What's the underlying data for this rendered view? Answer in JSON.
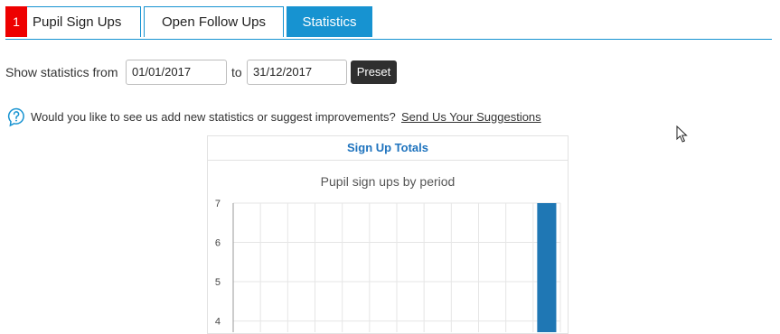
{
  "tabs": [
    {
      "badge": "1",
      "label": "Pupil Sign Ups"
    },
    {
      "label": "Open Follow Ups"
    },
    {
      "label": "Statistics",
      "active": true
    }
  ],
  "filter": {
    "prefix": "Show statistics from",
    "from": "01/01/2017",
    "to_label": "to",
    "to": "31/12/2017",
    "preset_label": "Preset"
  },
  "suggestion": {
    "text": "Would you like to see us add new statistics or suggest improvements?",
    "link": "Send Us Your Suggestions"
  },
  "panel": {
    "title": "Sign Up Totals"
  },
  "chart_data": {
    "type": "bar",
    "title": "Pupil sign ups by period",
    "y_ticks": [
      4,
      5,
      6,
      7
    ],
    "ylim_visible": [
      3.6,
      7
    ],
    "bar_color": "#1f77b4",
    "grid": true,
    "series": [
      {
        "values": [
          0,
          0,
          0,
          0,
          0,
          0,
          0,
          0,
          0,
          0,
          0,
          7
        ]
      }
    ]
  },
  "colors": {
    "accent": "#1793d1",
    "badge": "#ee0000",
    "link_title": "#1e73be"
  }
}
